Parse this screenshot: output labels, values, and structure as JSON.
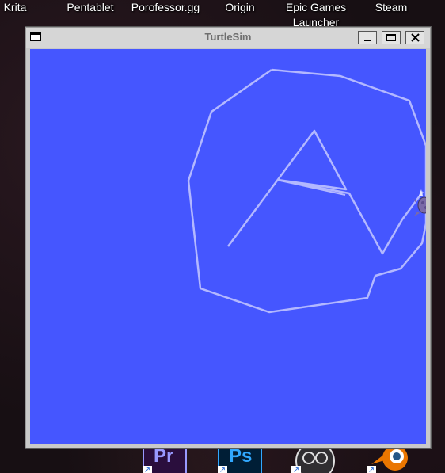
{
  "desktop": {
    "shortcuts": [
      {
        "label": "Krita"
      },
      {
        "label": "Pentablet"
      },
      {
        "label": "Porofessor.gg"
      },
      {
        "label": "Origin"
      },
      {
        "label": "Epic Games Launcher"
      },
      {
        "label": "Steam"
      }
    ],
    "taskbar_icons": [
      {
        "name": "premiere-pro-icon",
        "label": "Pr",
        "color": "#9999ff"
      },
      {
        "name": "photoshop-icon",
        "label": "Ps",
        "color": "#31a8ff"
      },
      {
        "name": "obs-icon",
        "label": "",
        "color": "#e0e0e0"
      },
      {
        "name": "blender-icon",
        "label": "",
        "color": "#ea7600"
      }
    ]
  },
  "window": {
    "title": "TurtleSim",
    "buttons": {
      "minimize_icon": "minimize-icon",
      "maximize_icon": "maximize-icon",
      "close_icon": "close-icon"
    }
  },
  "turtlesim": {
    "background_color": "#4556ff",
    "pen_color": "#b3b8ff",
    "turtle_icon": "turtle-icon"
  }
}
